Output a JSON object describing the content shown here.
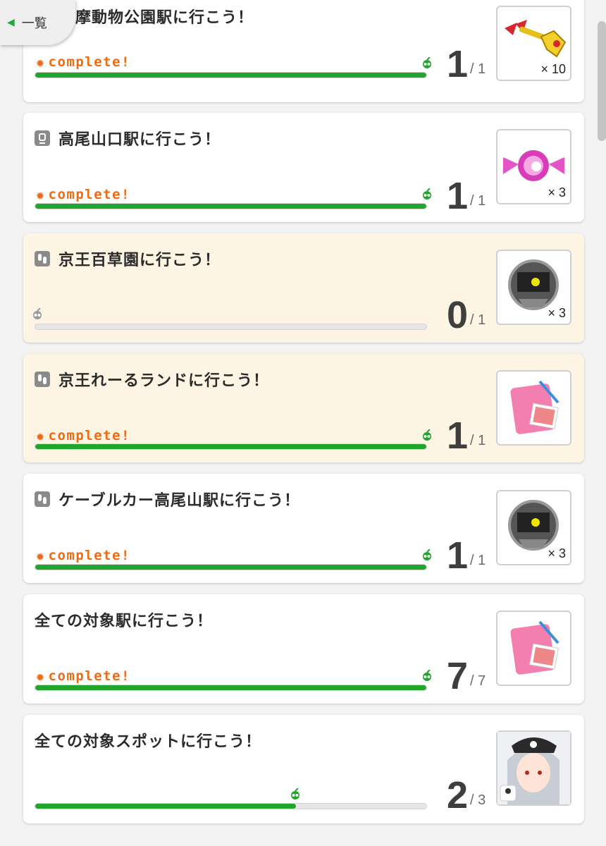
{
  "back_button": {
    "label": "一覧"
  },
  "complete_label": "complete!",
  "missions": [
    {
      "title": "摩動物公園駅に行こう！",
      "category": "none",
      "status": "complete",
      "progress": 1,
      "total_label": "/ 1",
      "current_label": "1",
      "reward": {
        "icon": "ribbon-key-icon",
        "qty": "× 10"
      },
      "highlight": false
    },
    {
      "title": "高尾山口駅に行こう！",
      "category": "train-icon",
      "status": "complete",
      "progress": 1,
      "total_label": "/ 1",
      "current_label": "1",
      "reward": {
        "icon": "candy-icon",
        "qty": "× 3"
      },
      "highlight": false
    },
    {
      "title": "京王百草園に行こう！",
      "category": "footprint-icon",
      "status": "incomplete",
      "progress": 0,
      "total_label": "/ 1",
      "current_label": "0",
      "reward": {
        "icon": "robot-ball-icon",
        "qty": "× 3"
      },
      "highlight": true
    },
    {
      "title": "京王れーるランドに行こう！",
      "category": "footprint-icon",
      "status": "complete",
      "progress": 1,
      "total_label": "/ 1",
      "current_label": "1",
      "reward": {
        "icon": "pink-album-icon",
        "qty": ""
      },
      "highlight": true
    },
    {
      "title": "ケーブルカー高尾山駅に行こう！",
      "category": "footprint-icon",
      "status": "complete",
      "progress": 1,
      "total_label": "/ 1",
      "current_label": "1",
      "reward": {
        "icon": "robot-ball-icon",
        "qty": "× 3"
      },
      "highlight": false
    },
    {
      "title": "全ての対象駅に行こう！",
      "category": "none",
      "status": "complete",
      "progress": 1,
      "total_label": "/ 7",
      "current_label": "7",
      "reward": {
        "icon": "pink-album-icon",
        "qty": ""
      },
      "highlight": false
    },
    {
      "title": "全ての対象スポットに行こう！",
      "category": "none",
      "status": "incomplete",
      "progress": 0.667,
      "total_label": "/ 3",
      "current_label": "2",
      "reward": {
        "icon": "character-portrait-icon",
        "qty": ""
      },
      "highlight": false
    }
  ],
  "colors": {
    "accent_green": "#21a52d",
    "complete_orange": "#f06a12",
    "highlight_bg": "#fdf4e3"
  }
}
